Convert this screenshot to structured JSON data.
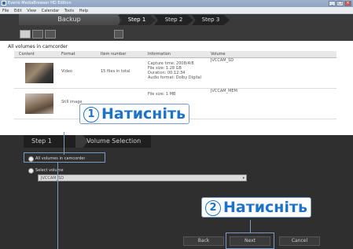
{
  "window": {
    "title": "Everio MediaBrowser HD Edition",
    "menu": [
      "File",
      "Edit",
      "View",
      "Calendar",
      "Tools",
      "Help"
    ]
  },
  "stepbar": {
    "mode": "Backup",
    "steps": [
      "Step 1",
      "Step 2",
      "Step 3"
    ]
  },
  "volume_list": {
    "title": "All volumes in camcorder",
    "columns": [
      "Content",
      "Format",
      "Item number",
      "Information",
      "Volume"
    ],
    "rows": [
      {
        "format": "Video",
        "items": "15 files in total",
        "info": [
          "Capture time: 2008/4/8",
          "File size: 1.28 GB",
          "Duration: 00:12:34",
          "Audio format: Dolby Digital"
        ],
        "volume": "JVCCAM_SD"
      },
      {
        "format": "Still image",
        "items": "",
        "info": [
          "File size: 1 MB"
        ],
        "volume": "JVCCAM_MEM"
      }
    ]
  },
  "callouts": {
    "one": {
      "number": "1",
      "text": "Натисніть"
    },
    "two": {
      "number": "2",
      "text": "Натисніть"
    }
  },
  "bottom_panel": {
    "tab_step": "Step 1",
    "tab_title": "Volume Selection",
    "radio_all": "All volumes in camcorder",
    "radio_select": "Select volume",
    "dropdown_value": "JVCCAM_SD"
  },
  "buttons": {
    "back": "Back",
    "next": "Next",
    "cancel": "Cancel"
  }
}
